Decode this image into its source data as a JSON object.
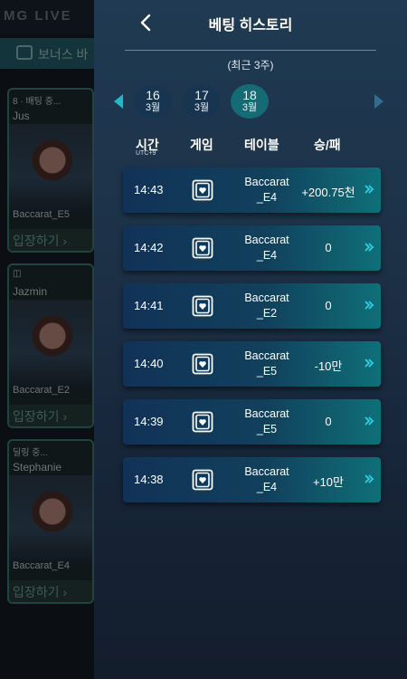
{
  "background": {
    "logo": "MG LIVE",
    "bonus_text": "보너스 바",
    "cards": [
      {
        "tag": "8 · 배팅 중...",
        "dealer": "Jus",
        "table": "Baccarat_E5",
        "enter": "입장하기 ›"
      },
      {
        "tag": "",
        "dealer": "Jazmin",
        "table": "Baccarat_E2",
        "enter": "입장하기 ›"
      },
      {
        "tag": "딜링 중...",
        "dealer": "Stephanie",
        "table": "Baccarat_E4",
        "enter": "입장하기 ›"
      }
    ]
  },
  "panel": {
    "title": "베팅 히스토리",
    "subtitle": "(최근 3주)",
    "dates": [
      {
        "day": "16",
        "month": "3월",
        "active": false
      },
      {
        "day": "17",
        "month": "3월",
        "active": false
      },
      {
        "day": "18",
        "month": "3월",
        "active": true
      }
    ],
    "columns": {
      "time": "시간",
      "timezone": "UTC+9",
      "game": "게임",
      "table": "테이블",
      "result": "승/패"
    },
    "rows": [
      {
        "time": "14:43",
        "table_line1": "Baccarat",
        "table_line2": "_E4",
        "result": "+200.75천"
      },
      {
        "time": "14:42",
        "table_line1": "Baccarat",
        "table_line2": "_E4",
        "result": "0"
      },
      {
        "time": "14:41",
        "table_line1": "Baccarat",
        "table_line2": "_E2",
        "result": "0"
      },
      {
        "time": "14:40",
        "table_line1": "Baccarat",
        "table_line2": "_E5",
        "result": "-10만"
      },
      {
        "time": "14:39",
        "table_line1": "Baccarat",
        "table_line2": "_E5",
        "result": "0"
      },
      {
        "time": "14:38",
        "table_line1": "Baccarat",
        "table_line2": "_E4",
        "result": "+10만"
      }
    ],
    "colors": {
      "accent": "#23b7c7",
      "active_date": "#156b73"
    }
  }
}
